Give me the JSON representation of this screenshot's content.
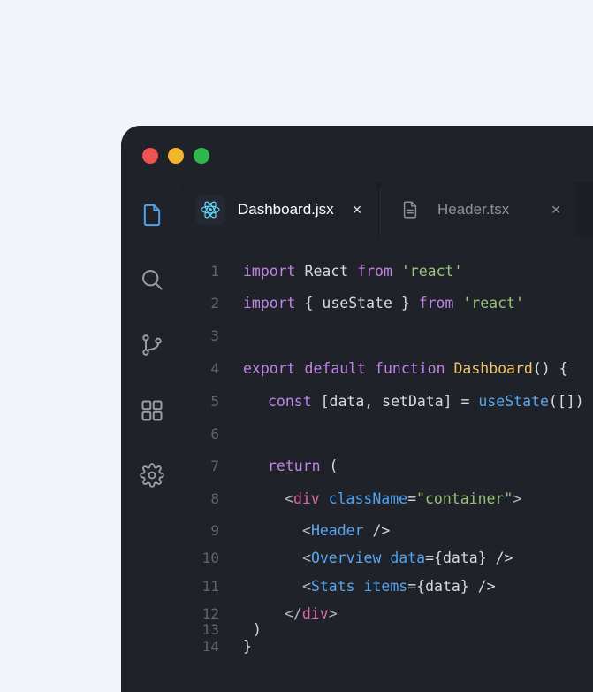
{
  "window": {
    "controls": [
      "close",
      "minimize",
      "maximize"
    ],
    "colors": {
      "close": "#f0524f",
      "minimize": "#f4b52d",
      "maximize": "#2fb84a"
    }
  },
  "activity_bar": {
    "items": [
      {
        "icon": "file-icon",
        "active": true
      },
      {
        "icon": "search-icon",
        "active": false
      },
      {
        "icon": "source-control-icon",
        "active": false
      },
      {
        "icon": "extensions-icon",
        "active": false
      },
      {
        "icon": "gear-icon",
        "active": false
      }
    ]
  },
  "tabs": [
    {
      "label": "Dashboard.jsx",
      "icon": "react-icon",
      "close": "×",
      "active": true
    },
    {
      "label": "Header.tsx",
      "icon": "document-icon",
      "close": "×",
      "active": false
    }
  ],
  "editor": {
    "lines": [
      {
        "n": "1",
        "tokens": [
          "import",
          " React ",
          "from",
          " ",
          "'react'"
        ]
      },
      {
        "n": "2",
        "tokens": [
          "import",
          " { useState } ",
          "from",
          " ",
          "'react'"
        ]
      },
      {
        "n": "3",
        "tokens": []
      },
      {
        "n": "4",
        "tokens": [
          "export",
          " ",
          "default",
          " ",
          "function",
          " ",
          "Dashboard",
          "() {"
        ]
      },
      {
        "n": "5",
        "tokens": [
          "const",
          " [data, setData] = ",
          "useState",
          "([])"
        ]
      },
      {
        "n": "6",
        "tokens": []
      },
      {
        "n": "7",
        "tokens": [
          "return",
          " ("
        ]
      },
      {
        "n": "8",
        "tokens": [
          "<",
          "div",
          " ",
          "className",
          "=",
          "\"container\"",
          ">"
        ]
      },
      {
        "n": "9",
        "tokens": [
          "<",
          "Header",
          " />"
        ]
      },
      {
        "n": "10",
        "tokens": [
          "<",
          "Overview",
          " ",
          "data",
          "={data} />"
        ]
      },
      {
        "n": "11",
        "tokens": [
          "<",
          "Stats",
          " ",
          "items",
          "={data} />"
        ]
      },
      {
        "n": "12",
        "tokens": [
          "</",
          "div",
          ">"
        ]
      },
      {
        "n": "13",
        "tokens": [
          ")"
        ]
      },
      {
        "n": "14",
        "tokens": [
          "}"
        ]
      }
    ]
  },
  "syntax_colors": {
    "keyword": "#c084e8",
    "string": "#98c379",
    "function": "#f3c46a",
    "component": "#5aa7f0",
    "attribute": "#4ea3f0",
    "tag": "#e06aa7"
  }
}
